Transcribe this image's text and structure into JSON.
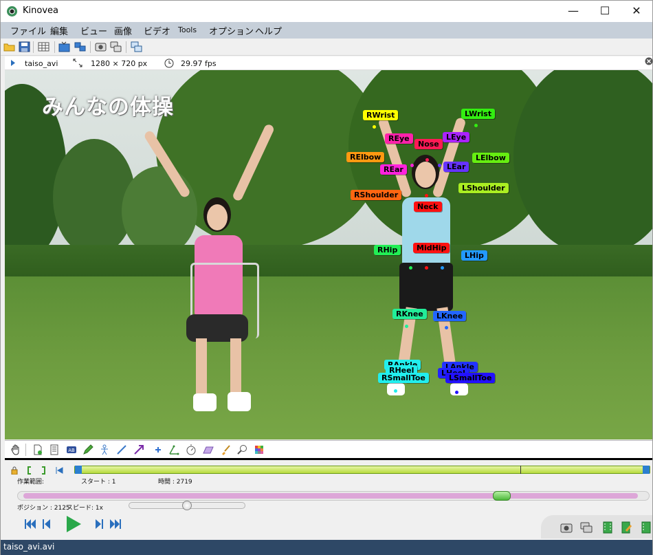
{
  "window": {
    "title": "Kinovea",
    "minimize_glyph": "—",
    "maximize_glyph": "☐",
    "close_glyph": "✕"
  },
  "menu": {
    "items": [
      "ファイル",
      "編集",
      "ビュー",
      "画像",
      "ビデオ",
      "Tools",
      "オプション",
      "ヘルプ"
    ]
  },
  "toolbar": {
    "icons": [
      "open-folder-icon",
      "save-icon",
      "grid-icon",
      "single-player-icon",
      "dual-player-icon",
      "capture-icon",
      "dual-capture-icon",
      "screens-icon"
    ]
  },
  "video_info": {
    "filename": "taiso_avi",
    "dimensions": "1280 × 720 px",
    "framerate": "29.97 fps"
  },
  "video": {
    "caption": "みんなの体操",
    "keypoints": [
      {
        "label": "RWrist",
        "color": "#ffff00"
      },
      {
        "label": "LWrist",
        "color": "#33ee11"
      },
      {
        "label": "REye",
        "color": "#ff22aa"
      },
      {
        "label": "Nose",
        "color": "#ff1a55"
      },
      {
        "label": "LEye",
        "color": "#aa22ff"
      },
      {
        "label": "RElbow",
        "color": "#ff9911"
      },
      {
        "label": "LElbow",
        "color": "#66ee11"
      },
      {
        "label": "REar",
        "color": "#ff22dd"
      },
      {
        "label": "LEar",
        "color": "#6633ff"
      },
      {
        "label": "LShoulder",
        "color": "#aaee22"
      },
      {
        "label": "RShoulder",
        "color": "#ff6611"
      },
      {
        "label": "Neck",
        "color": "#ff1111"
      },
      {
        "label": "RHip",
        "color": "#22ee55"
      },
      {
        "label": "MidHip",
        "color": "#ff1111"
      },
      {
        "label": "LHip",
        "color": "#2299ff"
      },
      {
        "label": "RKnee",
        "color": "#22ee99"
      },
      {
        "label": "LKnee",
        "color": "#2266ff"
      },
      {
        "label": "RAnkle",
        "color": "#22eeee"
      },
      {
        "label": "LAnkle",
        "color": "#2233ff"
      },
      {
        "label": "RHeel",
        "color": "#22eeee"
      },
      {
        "label": "LHeel",
        "color": "#2222ff"
      },
      {
        "label": "RSmallToe",
        "color": "#22eeee"
      },
      {
        "label": "LSmallToe",
        "color": "#2211ff"
      }
    ]
  },
  "controls": {
    "working_zone_label": "作業範囲:",
    "start_label": "スタート : 1",
    "time_label": "時間 : 2719",
    "position_label": "ポジション : 2125",
    "speed_label": "スピード: 1x",
    "position_fraction": 0.78,
    "speed_fraction": 0.5
  },
  "status": {
    "text": "taiso_avi.avi"
  }
}
